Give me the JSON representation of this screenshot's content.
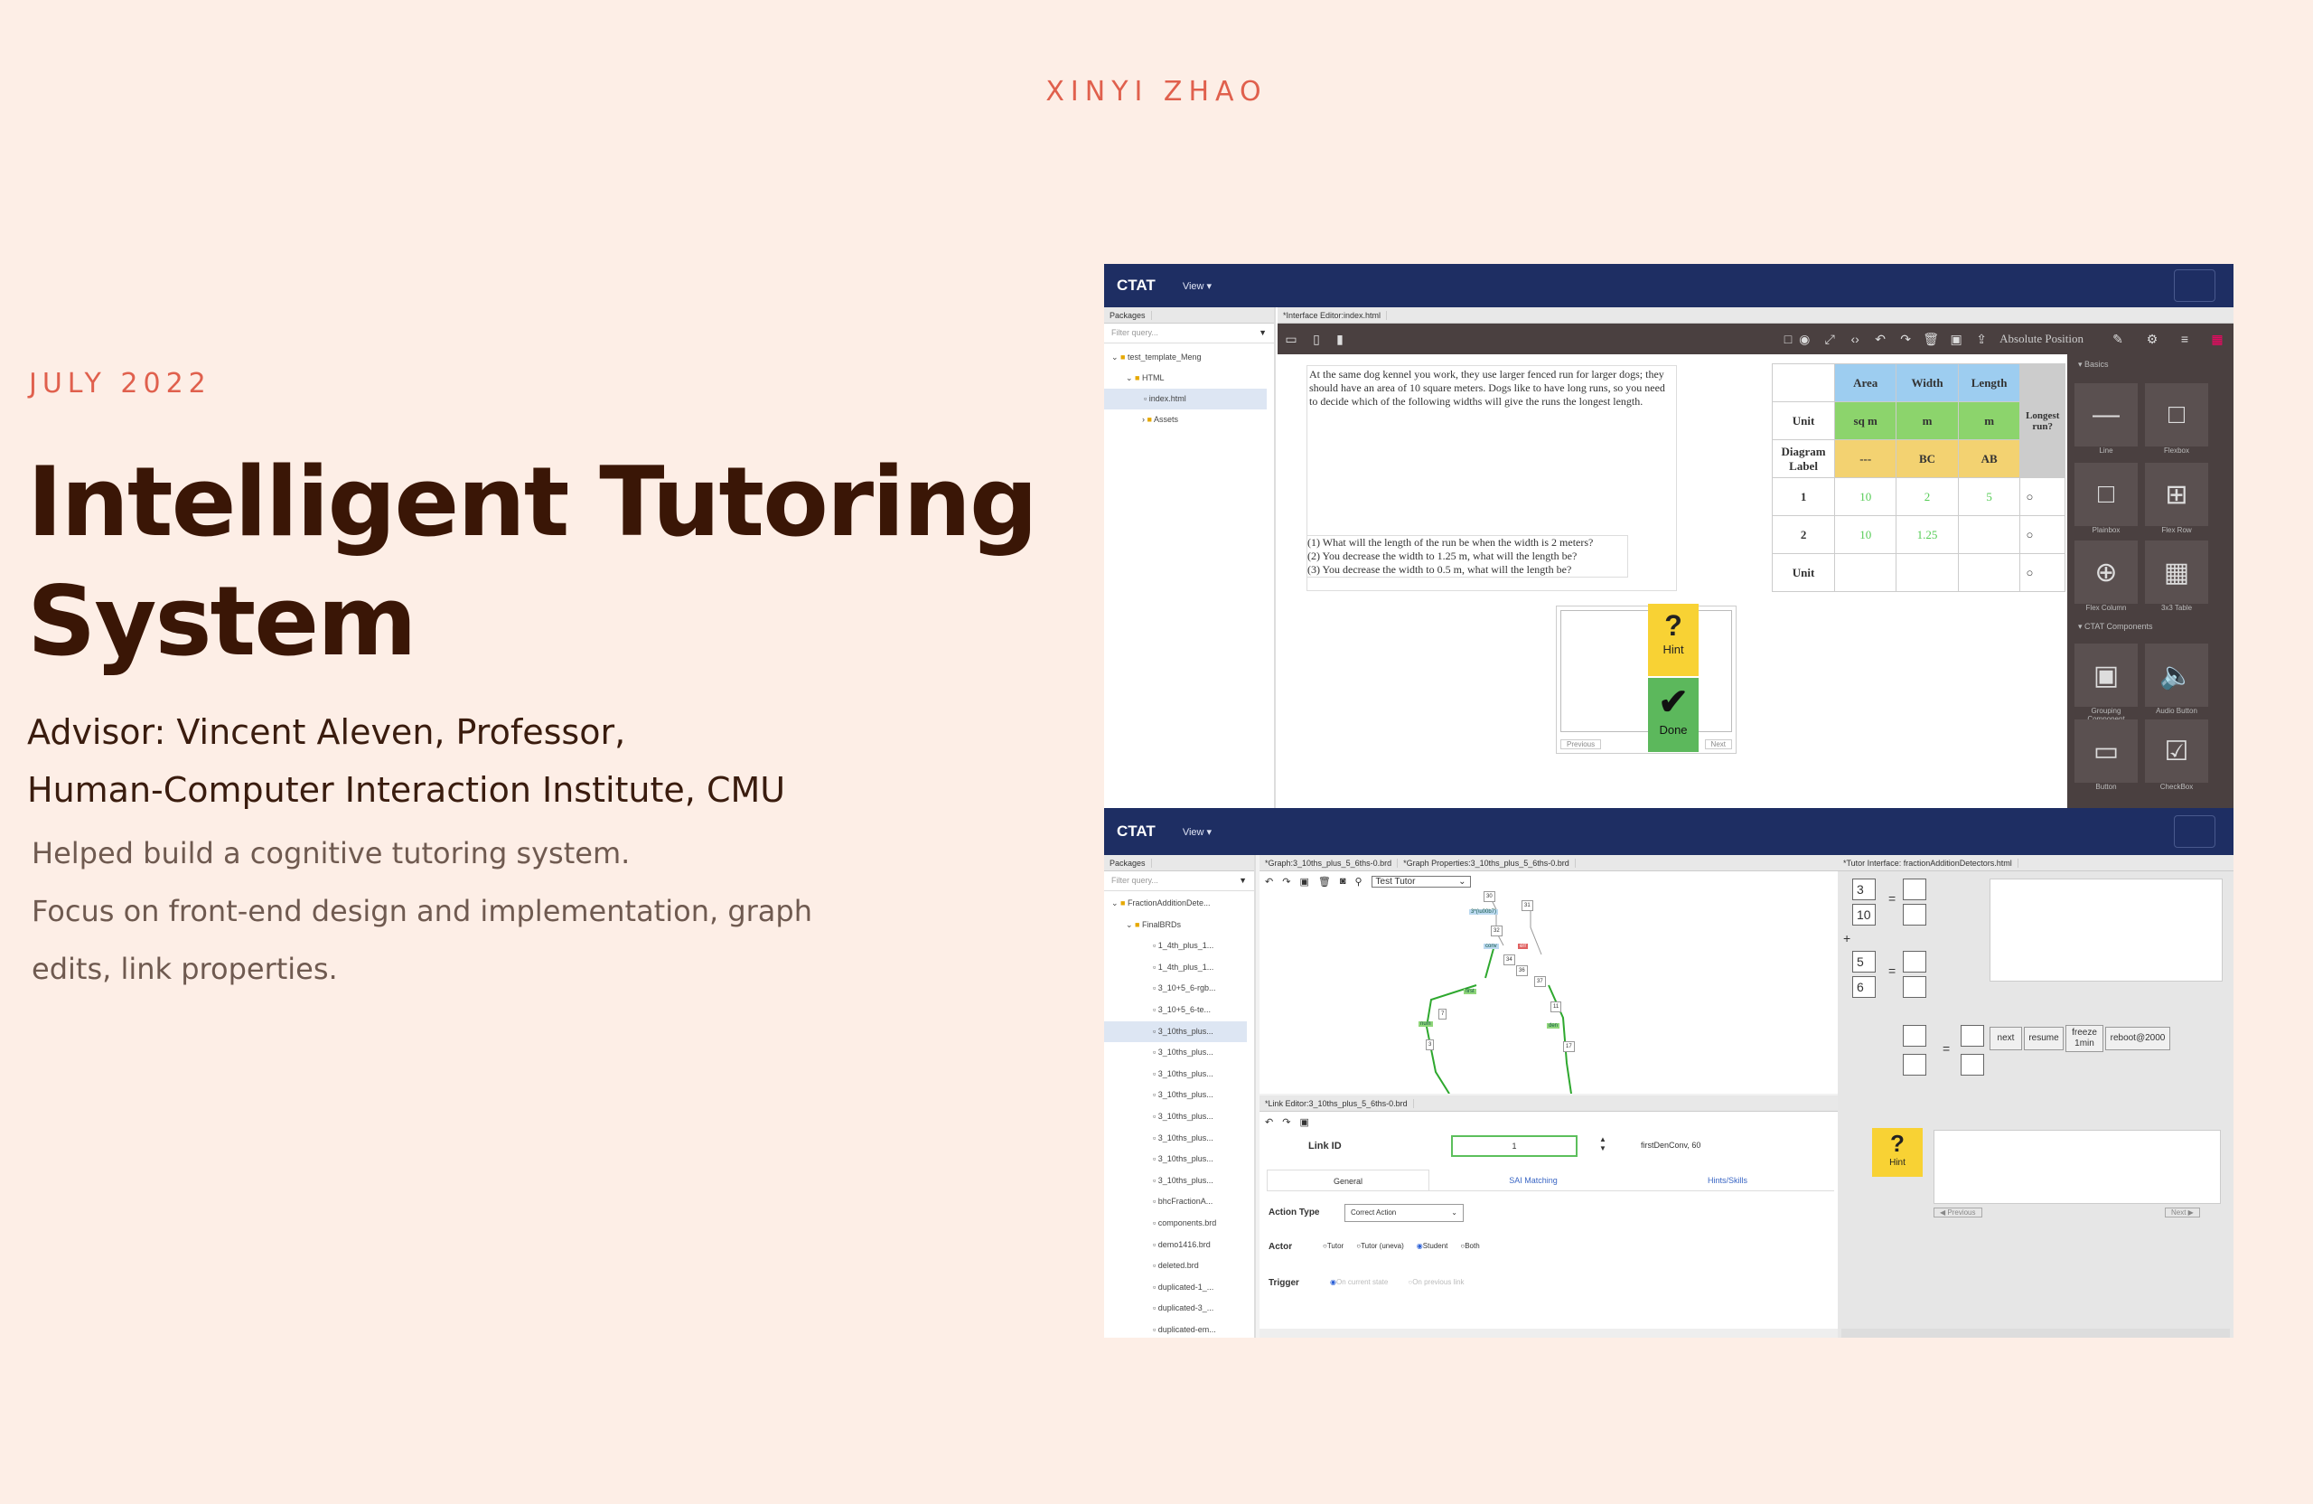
{
  "header": {
    "author": "XINYI ZHAO",
    "date": "JULY 2022"
  },
  "project": {
    "title_line1": "Intelligent Tutoring",
    "title_line2": "System",
    "advisor_line1": "Advisor: Vincent Aleven, Professor,",
    "advisor_line2": "Human-Computer Interaction Institute, CMU",
    "desc_line1": "Helped build a cognitive tutoring system.",
    "desc_line2": "Focus on front-end design and implementation, graph",
    "desc_line3": "edits, link properties."
  },
  "shot1": {
    "brand": "CTAT",
    "view": "View ▾",
    "packages_tab": "Packages",
    "editor_tab": "*Interface Editor:index.html",
    "filter_placeholder": "Filter query...",
    "tree": [
      "test_template_Meng",
      "HTML",
      "index.html",
      "Assets"
    ],
    "position_mode": "Absolute Position",
    "problem_text": "At the same dog kennel you work, they use larger fenced run for larger dogs; they should have an area of 10 square meters. Dogs like to have long runs, so you need to decide which of the following widths will give the runs the longest length.",
    "questions": [
      "(1) What will the length of the run be when the width is 2 meters?",
      "(2) You decrease the width to 1.25 m, what will the length be?",
      "(3) You decrease the width to 0.5 m, what will the length be?"
    ],
    "table": {
      "headers": [
        "Area",
        "Width",
        "Length"
      ],
      "row_unit": [
        "Unit",
        "sq m",
        "m",
        "m"
      ],
      "row_label": [
        "Diagram Label",
        "---",
        "BC",
        "AB"
      ],
      "row1": [
        "1",
        "10",
        "2",
        "5"
      ],
      "row2": [
        "2",
        "10",
        "1.25",
        ""
      ],
      "row3": [
        "Unit",
        "",
        "",
        ""
      ],
      "extra_header": "Longest run?"
    },
    "hint_label": "Hint",
    "done_label": "Done",
    "prev_label": "Previous",
    "next_label": "Next",
    "palette": {
      "basics_title": "Basics",
      "components_title": "CTAT Components",
      "items": [
        "Line",
        "Flexbox",
        "Plainbox",
        "Flex Row",
        "Flex Column",
        "3x3 Table",
        "Grouping Component",
        "Audio Button",
        "Button",
        "CheckBox"
      ]
    }
  },
  "shot2": {
    "brand": "CTAT",
    "view": "View ▾",
    "packages_tab": "Packages",
    "filter_placeholder": "Filter query...",
    "graph_tab1": "*Graph:3_10ths_plus_5_6ths-0.brd",
    "graph_tab2": "*Graph Properties:3_10ths_plus_5_6ths-0.brd",
    "tutor_tab": "*Tutor Interface: fractionAdditionDetectors.html",
    "tutor_select": "Test Tutor",
    "tree": [
      "FractionAdditionDete...",
      "FinalBRDs",
      "1_4th_plus_1...",
      "1_4th_plus_1...",
      "3_10+5_6-rgb...",
      "3_10+5_6-te...",
      "3_10ths_plus...",
      "3_10ths_plus...",
      "3_10ths_plus...",
      "3_10ths_plus...",
      "3_10ths_plus...",
      "3_10ths_plus...",
      "3_10ths_plus...",
      "3_10ths_plus...",
      "bhcFractionA...",
      "components.brd",
      "demo1416.brd",
      "deleted.brd",
      "duplicated-1_...",
      "duplicated-3_...",
      "duplicated-em..."
    ],
    "link_editor_tab": "*Link Editor:3_10ths_plus_5_6ths-0.brd",
    "link_id_label": "Link ID",
    "link_id_value": "1",
    "link_target": "firstDenConv, 60",
    "tabs": [
      "General",
      "SAI Matching",
      "Hints/Skills"
    ],
    "action_type_label": "Action Type",
    "action_type_value": "Correct Action",
    "actor_label": "Actor",
    "actor_options": [
      "Tutor",
      "Tutor (uneva)",
      "Student",
      "Both"
    ],
    "trigger_label": "Trigger",
    "trigger_options": [
      "On current state",
      "On previous link"
    ],
    "fractions": [
      "3",
      "10",
      "5",
      "6"
    ],
    "eq": "=",
    "plus": "+",
    "buttons": [
      "next",
      "resume",
      "freeze 1min",
      "reboot@2000"
    ],
    "hint_label": "Hint",
    "prev_label": "◀ Previous",
    "next_label": "Next ▶"
  }
}
